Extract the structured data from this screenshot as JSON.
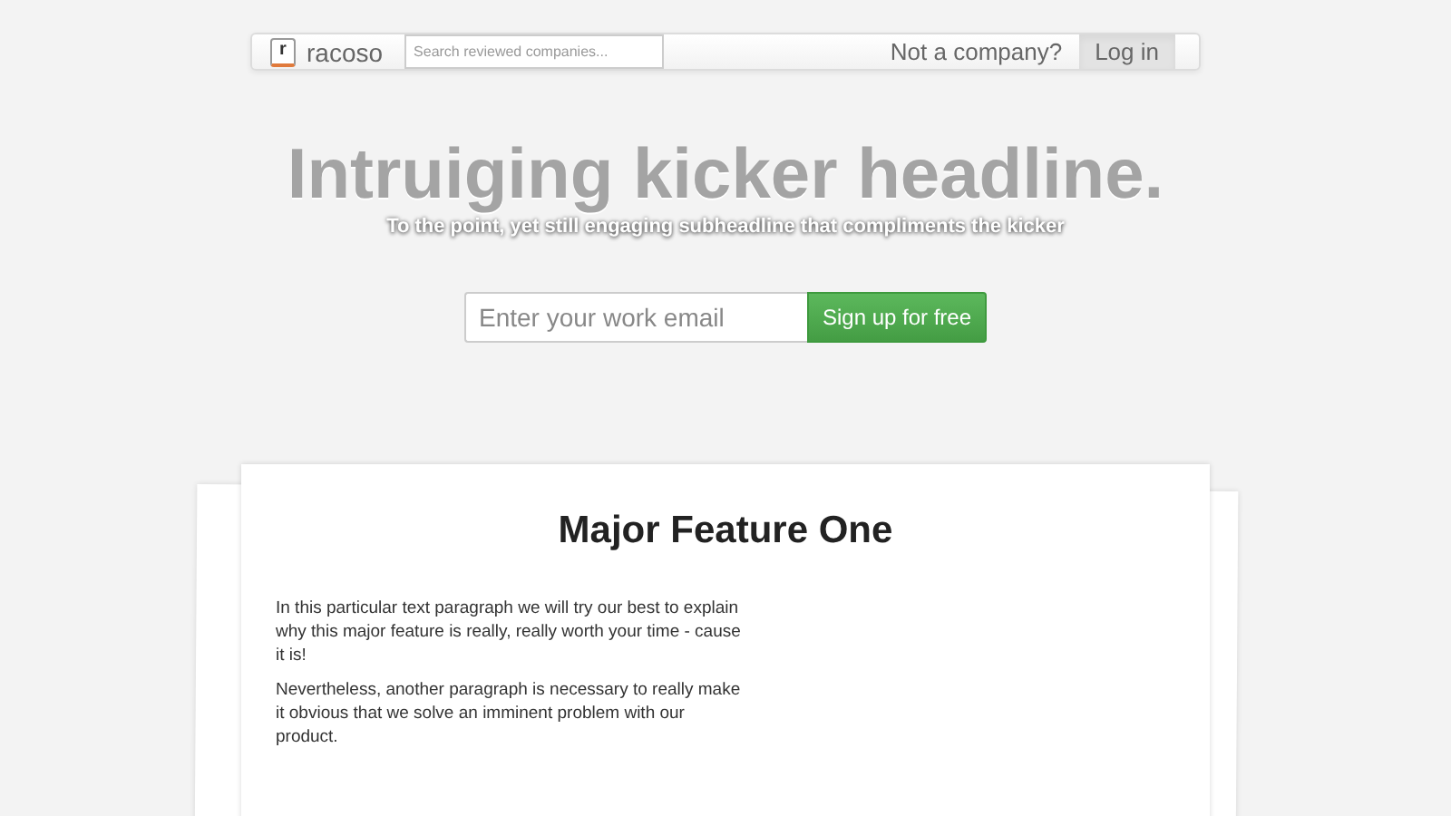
{
  "navbar": {
    "logo_letter": "r",
    "brand": "racoso",
    "search": {
      "placeholder": "Search reviewed companies..."
    },
    "links": [
      {
        "label": "Not a company?",
        "selected": false
      },
      {
        "label": "Log in",
        "selected": true
      }
    ]
  },
  "hero": {
    "headline": "Intruiging kicker headline.",
    "subheadline": "To the point, yet still engaging subheadline that compliments the kicker",
    "email": {
      "placeholder": "Enter your work email"
    },
    "button": "Sign up for free"
  },
  "feature": {
    "title": "Major Feature One",
    "paragraphs": [
      "In this particular text paragraph we will try our best to explain why this major feature is really, really worth your time - cause it is!",
      "Nevertheless, another paragraph is necessary to really make it obvious that we solve an imminent problem with our product."
    ]
  }
}
